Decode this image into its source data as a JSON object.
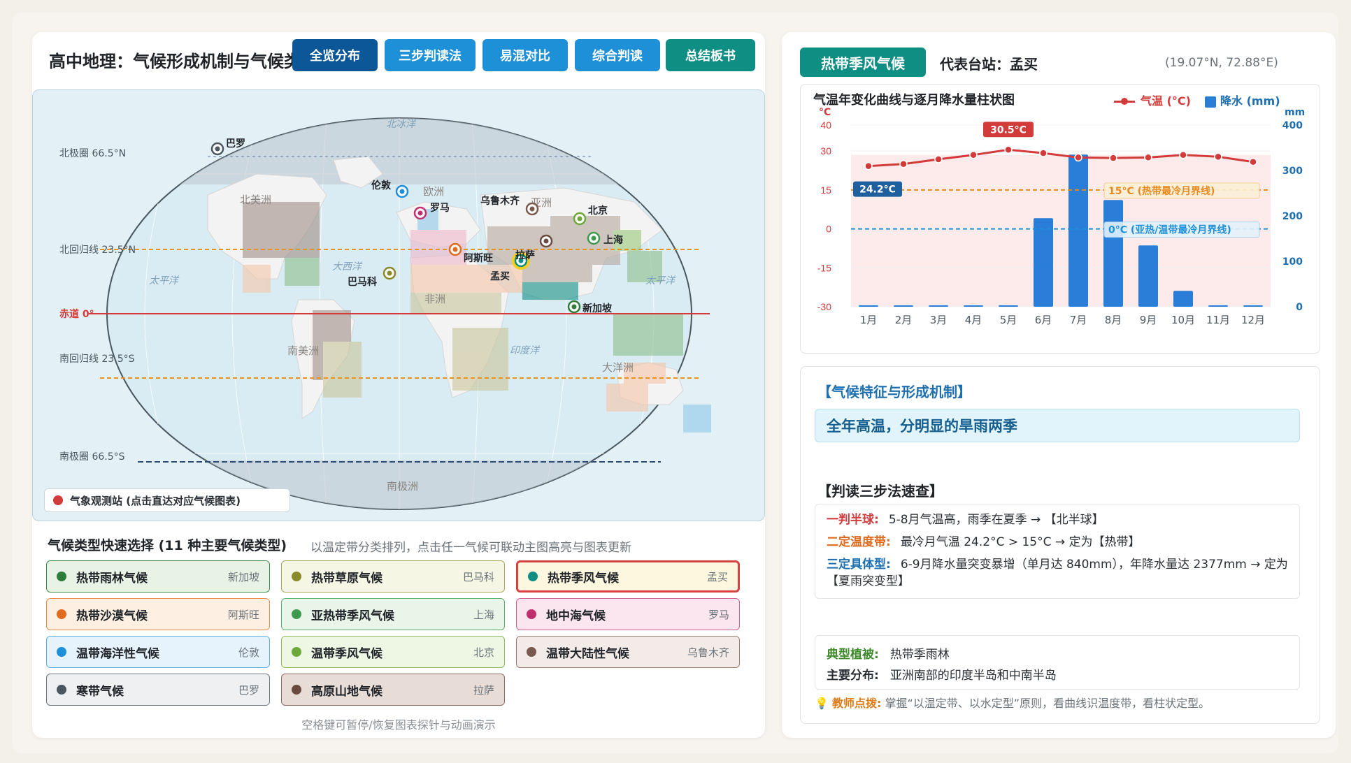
{
  "header": {
    "title": "高中地理：气候形成机制与气候类",
    "nav_buttons": [
      {
        "label": "全览分布",
        "active": true
      },
      {
        "label": "三步判读法"
      },
      {
        "label": "易混对比"
      },
      {
        "label": "综合判读"
      },
      {
        "label": "总结板书"
      }
    ]
  },
  "map": {
    "lat_lines": {
      "arctic": "北极圈 66.5°N",
      "cancer": "北回归线 23.5°N",
      "equator": "赤道 0°",
      "capricorn": "南回归线 23.5°S",
      "antarctic": "南极圈 66.5°S"
    },
    "region_labels": [
      "北冰洋",
      "北美洲",
      "欧洲",
      "亚洲",
      "大西洋",
      "太平洋",
      "太平洋",
      "非洲",
      "南美洲",
      "印度洋",
      "大洋洲",
      "南极洲"
    ],
    "stations": [
      {
        "name": "巴罗",
        "color": "#4b5660"
      },
      {
        "name": "伦敦",
        "color": "#1e90d8"
      },
      {
        "name": "罗马",
        "color": "#c0306e"
      },
      {
        "name": "乌鲁木齐",
        "color": "#7a5a4e"
      },
      {
        "name": "北京",
        "color": "#6fa83a"
      },
      {
        "name": "上海",
        "color": "#3e9a4e"
      },
      {
        "name": "阿斯旺",
        "color": "#e06a1e"
      },
      {
        "name": "拉萨",
        "color": "#6b4a40"
      },
      {
        "name": "孟买",
        "color": "#0f8f84"
      },
      {
        "name": "巴马科",
        "color": "#8a8a2a"
      },
      {
        "name": "新加坡",
        "color": "#2e7d3a"
      }
    ],
    "legend": "气象观测站 (点击直达对应气候图表)"
  },
  "chooser": {
    "title": "气候类型快速选择 (11 种主要气候类型)",
    "subtitle": "以温定带分类排列，点击任一气候可联动主图高亮与图表更新",
    "items": [
      {
        "name": "热带雨林气候",
        "station": "新加坡",
        "color": "#2e7d3a",
        "bg": "#e8f3e6",
        "border": "#3e8a4a"
      },
      {
        "name": "热带草原气候",
        "station": "巴马科",
        "color": "#8a8a2a",
        "bg": "#f6f6e4",
        "border": "#a8a85a"
      },
      {
        "name": "热带季风气候",
        "station": "孟买",
        "color": "#0f8f84",
        "bg": "#fdf7df",
        "border": "#d94040"
      },
      {
        "name": "热带沙漠气候",
        "station": "阿斯旺",
        "color": "#e06a1e",
        "bg": "#fdf0e2",
        "border": "#e58a4a"
      },
      {
        "name": "亚热带季风气候",
        "station": "上海",
        "color": "#3e9a4e",
        "bg": "#eaf5ea",
        "border": "#5aaa6a"
      },
      {
        "name": "地中海气候",
        "station": "罗马",
        "color": "#c0306e",
        "bg": "#fbe6ef",
        "border": "#d06090"
      },
      {
        "name": "温带海洋性气候",
        "station": "伦敦",
        "color": "#1e90d8",
        "bg": "#e6f3fc",
        "border": "#5aaee6"
      },
      {
        "name": "温带季风气候",
        "station": "北京",
        "color": "#6fa83a",
        "bg": "#eef6e4",
        "border": "#8aba5a"
      },
      {
        "name": "温带大陆性气候",
        "station": "乌鲁木齐",
        "color": "#7a5a4e",
        "bg": "#f3ebe7",
        "border": "#9a7a6e"
      },
      {
        "name": "寒带气候",
        "station": "巴罗",
        "color": "#4b5660",
        "bg": "#eef0f2",
        "border": "#6b7680"
      },
      {
        "name": "高原山地气候",
        "station": "拉萨",
        "color": "#6b4a40",
        "bg": "#e8dcd6",
        "border": "#8a6a60"
      }
    ],
    "hint": "空格键可暂停/恢复图表探针与动画演示"
  },
  "detail": {
    "climate_tag": "热带季风气候",
    "station_label": "代表台站：孟买",
    "coords": "(19.07°N, 72.88°E)",
    "legend_temp": "气温 (°C)",
    "legend_precip": "降水 (mm)",
    "section1": "【气候特征与形成机制】",
    "feature": "全年高温，分明显的旱雨两季",
    "section2": "【判读三步法速查】",
    "steps": [
      {
        "key": "一判半球:",
        "text": "5-8月气温高，雨季在夏季 → 【北半球】",
        "color": "#d33a3a"
      },
      {
        "key": "二定温度带:",
        "text": "最冷月气温 24.2°C > 15°C → 定为【热带】",
        "color": "#e06a1e"
      },
      {
        "key": "三定具体型:",
        "text": "6-9月降水量突变暴增（单月达 840mm），年降水量达 2377mm → 定为【夏雨突变型】",
        "color": "#1e6fb0"
      }
    ],
    "vegetation_key": "典型植被:",
    "vegetation": "热带季雨林",
    "distribution_key": "主要分布:",
    "distribution": "亚洲南部的印度半岛和中南半岛",
    "tip_key": "教师点拨:",
    "tip": "掌握“以温定带、以水定型”原则，看曲线识温度带，看柱状定型。"
  },
  "chart_data": {
    "type": "bar",
    "title": "气温年变化曲线与逐月降水量柱状图",
    "categories": [
      "1月",
      "2月",
      "3月",
      "4月",
      "5月",
      "6月",
      "7月",
      "8月",
      "9月",
      "10月",
      "11月",
      "12月"
    ],
    "series": [
      {
        "name": "气温 (°C)",
        "type": "line",
        "axis": "left",
        "values": [
          24.2,
          25.0,
          26.8,
          28.5,
          30.5,
          29.2,
          27.5,
          27.3,
          27.5,
          28.5,
          27.8,
          25.8
        ]
      },
      {
        "name": "降水 (mm)",
        "type": "bar",
        "axis": "right",
        "values": [
          1,
          1,
          1,
          1,
          2,
          195,
          335,
          235,
          135,
          35,
          2,
          1
        ]
      }
    ],
    "y_left": {
      "unit": "°C",
      "ylim": [
        -30,
        40
      ],
      "ticks": [
        40,
        30,
        15,
        0,
        -15,
        -30
      ]
    },
    "y_right": {
      "unit": "mm",
      "ylim": [
        0,
        400
      ],
      "ticks": [
        400,
        300,
        200,
        100,
        0
      ]
    },
    "reference_lines": [
      {
        "value": 15,
        "label": "15°C (热带最冷月界线)",
        "color": "#e88a1e"
      },
      {
        "value": 0,
        "label": "0°C (亚热/温带最冷月界线)",
        "color": "#1e90d8"
      }
    ],
    "annotations": [
      {
        "label": "30.5°C",
        "month": "5月",
        "kind": "max"
      },
      {
        "label": "24.2°C",
        "month": "1月",
        "kind": "min"
      }
    ]
  }
}
